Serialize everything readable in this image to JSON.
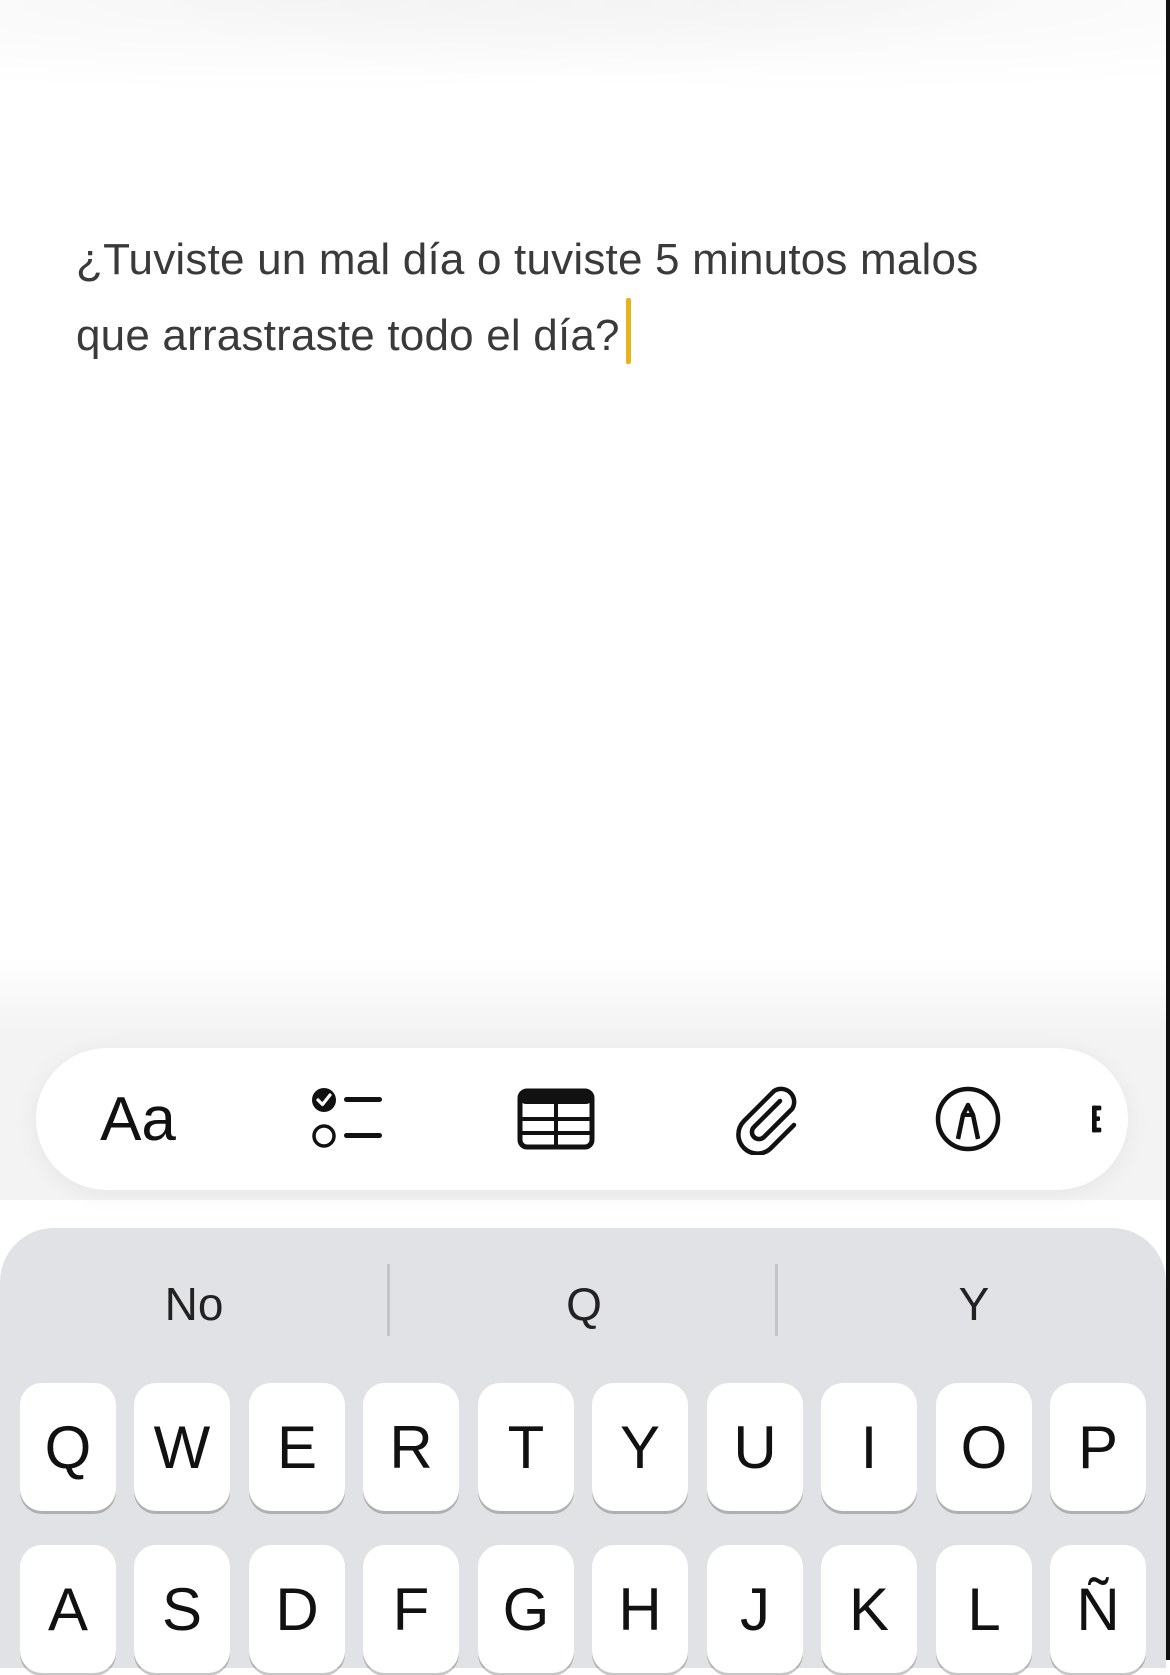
{
  "note": {
    "line_1": "¿Tuviste un mal día o tuviste 5 minutos malos",
    "line_2": "que arrastraste todo el día?"
  },
  "toolbar": {
    "format_label": "Aa",
    "icons": [
      "checklist-icon",
      "table-icon",
      "paperclip-icon",
      "markup-pen-icon",
      "more-icon"
    ]
  },
  "keyboard": {
    "suggestions": [
      "No",
      "Q",
      "Y"
    ],
    "row_1": [
      "Q",
      "W",
      "E",
      "R",
      "T",
      "Y",
      "U",
      "I",
      "O",
      "P"
    ],
    "row_2": [
      "A",
      "S",
      "D",
      "F",
      "G",
      "H",
      "J",
      "K",
      "L",
      "Ñ"
    ]
  },
  "colors": {
    "caret": "#e8b21e",
    "text": "#3a3a3a",
    "keyboard_bg": "#e0e2e5",
    "key_bg": "#ffffff"
  }
}
